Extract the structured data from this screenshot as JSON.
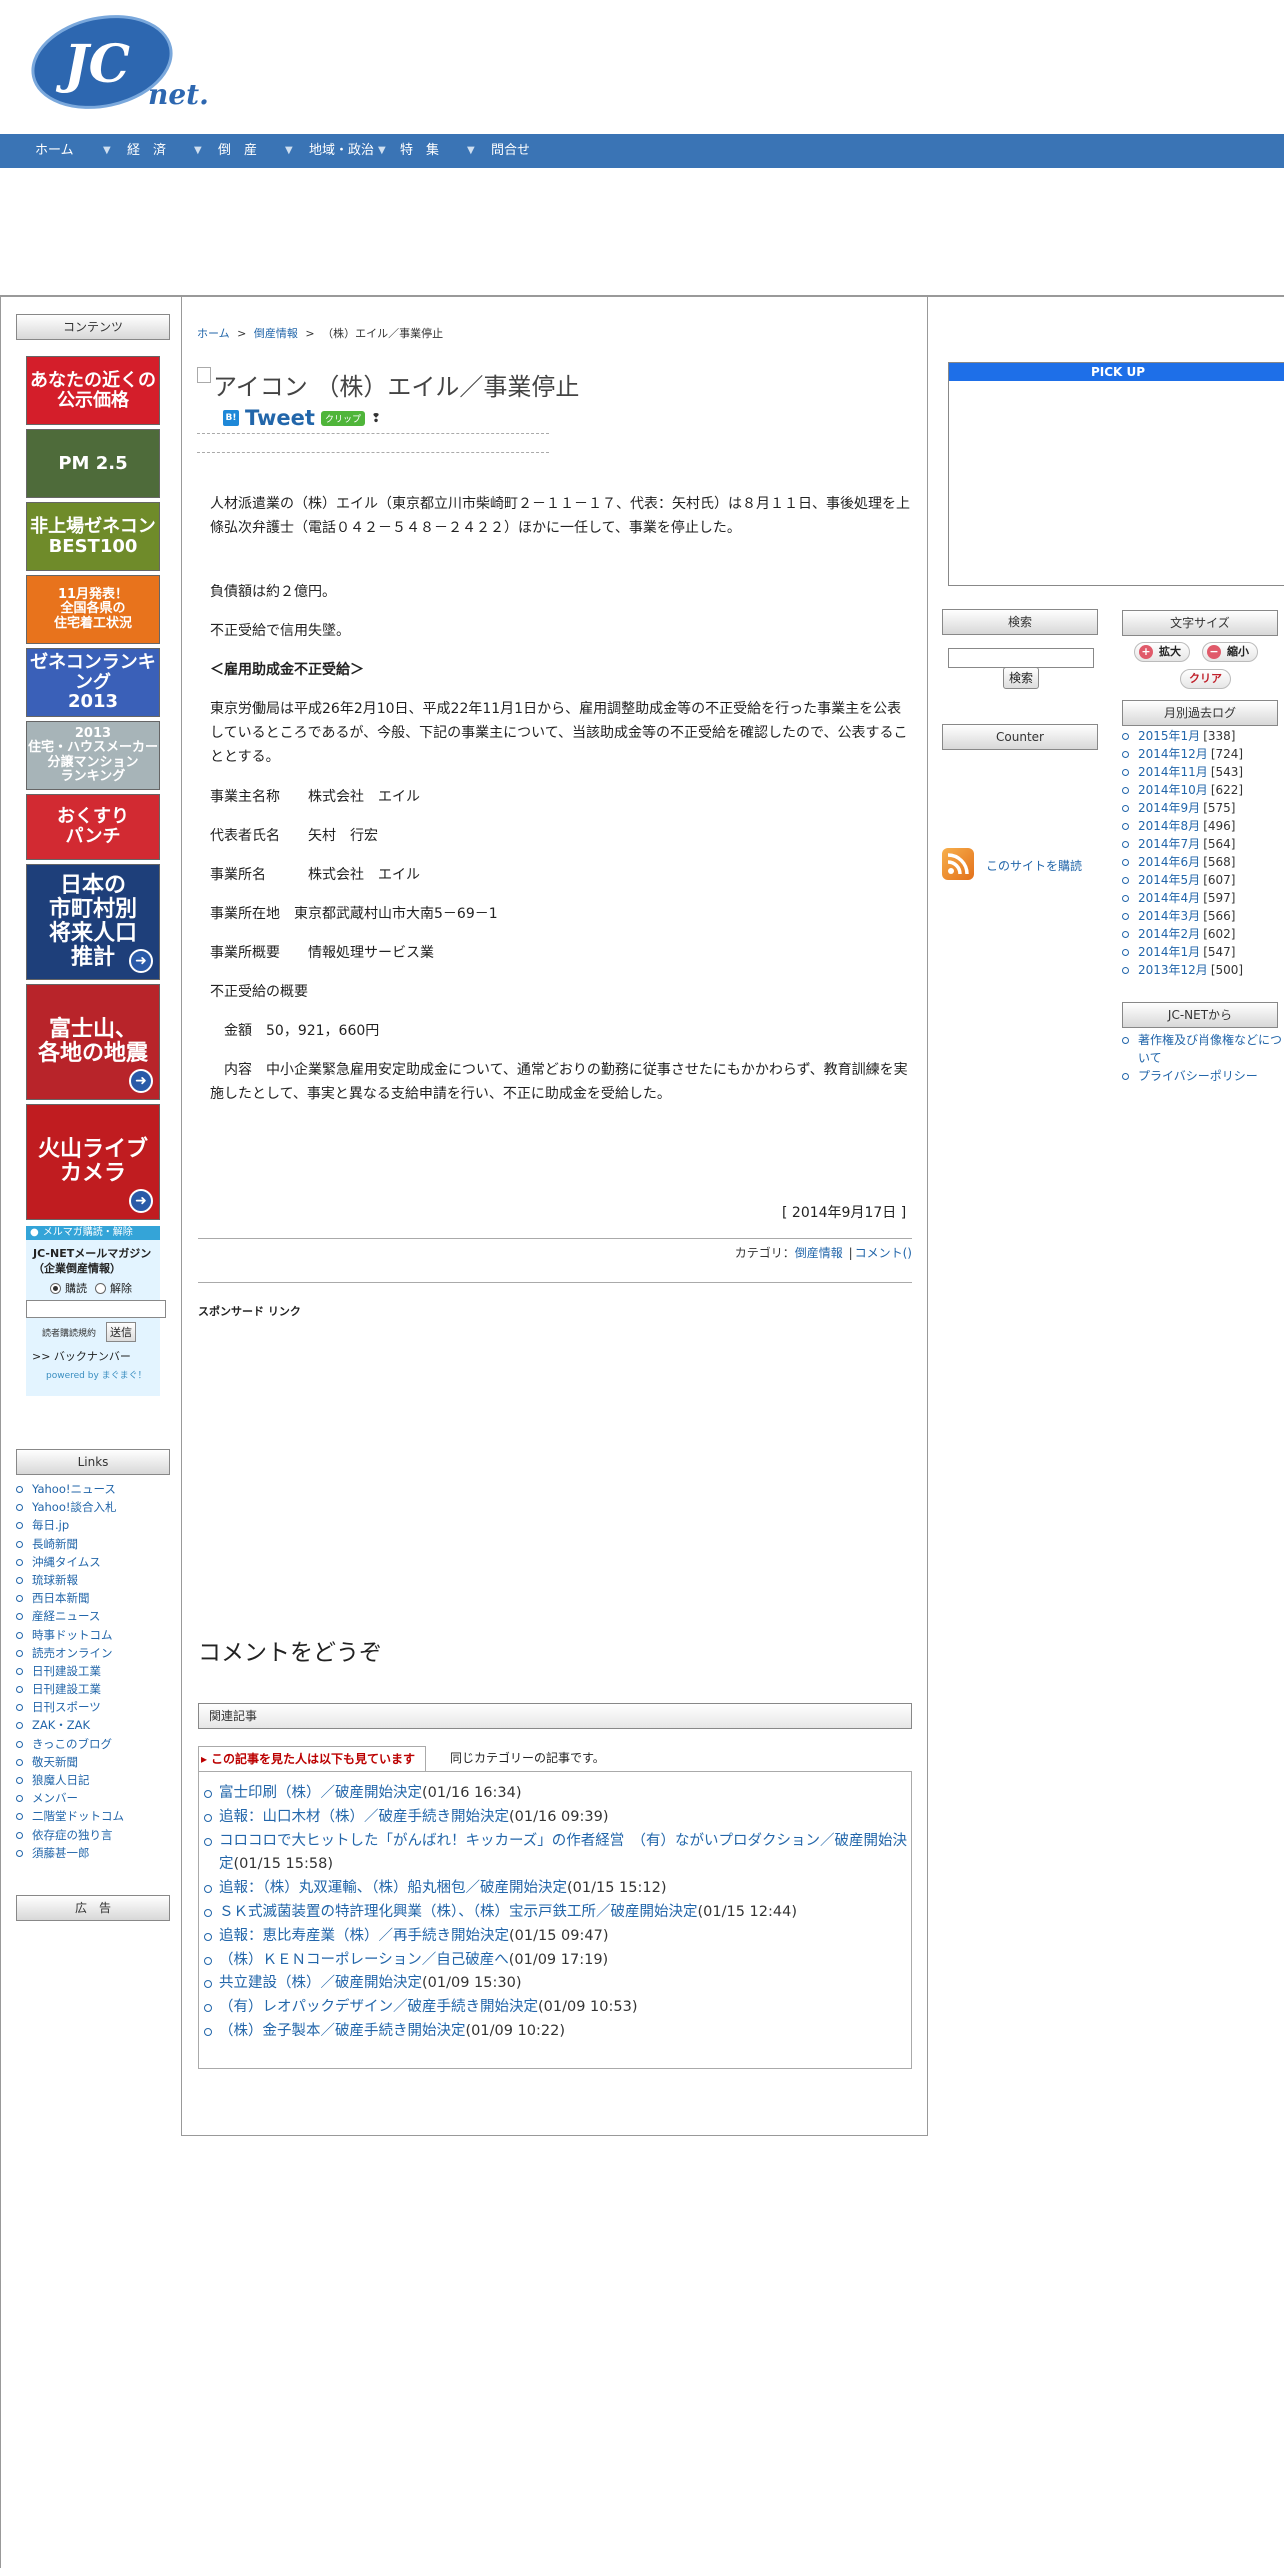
{
  "logo": {
    "text_main": "JC",
    "text_sub": "net."
  },
  "nav": {
    "items": [
      {
        "label": "ホーム"
      },
      {
        "label": "経　済"
      },
      {
        "label": "倒　産"
      },
      {
        "label": "地域・政治"
      },
      {
        "label": "特　集"
      },
      {
        "label": "問合せ"
      }
    ],
    "caret": "▼"
  },
  "left_sidebar": {
    "contents_label": "コンテンツ",
    "banners": [
      {
        "text": "あなたの近くの\n公示価格",
        "bg": "#d41e2a"
      },
      {
        "text": "PM 2.5",
        "bg": "#4e6b3a"
      },
      {
        "text": "非上場ゼネコン\nBEST100",
        "bg": "#6f8b2a"
      },
      {
        "text": "11月発表！\n全国各県の\n住宅着工状況",
        "bg": "#e8731c"
      },
      {
        "text": "ゼネコンランキング\n2013",
        "bg": "#3a60b8"
      },
      {
        "text": "2013\n住宅・ハウスメーカー\n分譲マンション\nランキング",
        "bg": "#a7b4b8"
      },
      {
        "text": "おくすり\nパンチ",
        "bg": "#d22a32"
      },
      {
        "text": "日本の\n市町村別\n将来人口\n推計",
        "bg": "#1e3f7a"
      },
      {
        "text": "富士山、\n各地の地震",
        "bg": "#b8242a"
      },
      {
        "text": "火山ライブ\nカメラ",
        "bg": "#c01c20"
      }
    ],
    "mailmag": {
      "header": "メルマガ購読・解除",
      "title": "JC-NETメールマガジン（企業倒産情報）",
      "subscribe": "購読",
      "unsubscribe": "解除",
      "terms": "読者購読規約",
      "submit": "送信",
      "backnumber": ">> バックナンバー",
      "powered": "powered by まぐまぐ！"
    },
    "links_label": "Links",
    "links": [
      "Yahoo!ニュース",
      "Yahoo!談合入札",
      "毎日.jp",
      "長崎新聞",
      "沖縄タイムス",
      "琉球新報",
      "西日本新聞",
      "産経ニュース",
      "時事ドットコム",
      "読売オンライン",
      "日刊建設工業",
      "日刊建設工業",
      "日刊スポーツ",
      "ZAK・ZAK",
      "きっこのブログ",
      "敬天新聞",
      "狼魔人日記",
      "メンバー",
      "二階堂ドットコム",
      "依存症の独り言",
      "須藤甚一郎"
    ],
    "ad_label": "広　告"
  },
  "breadcrumb": {
    "home": "ホーム",
    "sep": ">",
    "category": "倒産情報",
    "current": "（株）エイル／事業停止"
  },
  "article": {
    "title": "アイコン （株）エイル／事業停止",
    "tweet": "Tweet",
    "clip": "クリップ",
    "paragraphs": [
      "人材派遣業の（株）エイル（東京都立川市柴崎町２－１１－１７、代表：矢村氏）は８月１１日、事後処理を上條弘次弁護士（電話０４２－５４８－２４２２）ほかに一任して、事業を停止した。",
      "負債額は約２億円。",
      "不正受給で信用失墜。",
      "＜雇用助成金不正受給＞",
      "東京労働局は平成26年2月10日、平成22年11月1日から、雇用調整助成金等の不正受給を行った事業主を公表しているところであるが、今般、下記の事業主について、当該助成金等の不正受給を確認したので、公表することとする。",
      "事業主名称　　株式会社　エイル",
      "代表者氏名　　矢村　行宏",
      "事業所名　　　株式会社　エイル",
      "事業所在地　東京都武蔵村山市大南5－69－1",
      "事業所概要　　情報処理サービス業",
      "不正受給の概要",
      "　金額　50，921，660円",
      "　内容　中小企業緊急雇用安定助成金について、通常どおりの勤務に従事させたにもかかわらず、教育訓練を実施したとして、事実と異なる支給申請を行い、不正に助成金を受給した。"
    ],
    "date": "[ 2014年9月17日 ]",
    "category_label": "カテゴリ：",
    "category_value": "倒産情報",
    "category_sep": "|",
    "comment_link": "コメント()",
    "sponsored": "スポンサード リンク",
    "comment_heading": "コメントをどうぞ"
  },
  "related": {
    "heading": "関連記事",
    "tab_active": "この記事を見た人は以下も見ています",
    "tab_other": "同じカテゴリーの記事です。",
    "items": [
      {
        "title": "富士印刷（株）／破産開始決定",
        "date": "(01/16 16:34)"
      },
      {
        "title": "追報：山口木材（株）／破産手続き開始決定",
        "date": "(01/16 09:39)"
      },
      {
        "title": "コロコロで大ヒットした「がんばれ！キッカーズ」の作者経営　（有）ながいプロダクション／破産開始決定",
        "date": "(01/15 15:58)"
      },
      {
        "title": "追報：（株）丸双運輸、（株）船丸梱包／破産開始決定",
        "date": "(01/15 15:12)"
      },
      {
        "title": "ＳＫ式滅菌装置の特許理化興業（株）、（株）宝示戸鉄工所／破産開始決定",
        "date": "(01/15 12:44)"
      },
      {
        "title": "追報：恵比寿産業（株）／再手続き開始決定",
        "date": "(01/15 09:47)"
      },
      {
        "title": "（株）ＫＥＮコーポレーション／自己破産へ",
        "date": "(01/09 17:19)"
      },
      {
        "title": "共立建設（株）／破産開始決定",
        "date": "(01/09 15:30)"
      },
      {
        "title": "（有）レオパックデザイン／破産手続き開始決定",
        "date": "(01/09 10:53)"
      },
      {
        "title": "（株）金子製本／破産手続き開始決定",
        "date": "(01/09 10:22)"
      }
    ]
  },
  "right_sidebar": {
    "pickup": "PICK UP",
    "search_label": "検索",
    "search_button": "検索",
    "counter_label": "Counter",
    "rss_text": "このサイトを購読",
    "fontsize_label": "文字サイズ",
    "fs_large": "拡大",
    "fs_small": "縮小",
    "fs_clear": "クリア",
    "archive_label": "月別過去ログ",
    "archive": [
      {
        "month": "2015年1月",
        "count": "[338]"
      },
      {
        "month": "2014年12月",
        "count": "[724]"
      },
      {
        "month": "2014年11月",
        "count": "[543]"
      },
      {
        "month": "2014年10月",
        "count": "[622]"
      },
      {
        "month": "2014年9月",
        "count": "[575]"
      },
      {
        "month": "2014年8月",
        "count": "[496]"
      },
      {
        "month": "2014年7月",
        "count": "[564]"
      },
      {
        "month": "2014年6月",
        "count": "[568]"
      },
      {
        "month": "2014年5月",
        "count": "[607]"
      },
      {
        "month": "2014年4月",
        "count": "[597]"
      },
      {
        "month": "2014年3月",
        "count": "[566]"
      },
      {
        "month": "2014年2月",
        "count": "[602]"
      },
      {
        "month": "2014年1月",
        "count": "[547]"
      },
      {
        "month": "2013年12月",
        "count": "[500]"
      }
    ],
    "jcnet_label": "JC-NETから",
    "jcnet_links": [
      "著作権及び肖像権などについて",
      "プライバシーポリシー"
    ]
  },
  "colors": {
    "nav_bg": "#3a74b5",
    "link": "#2266aa",
    "pickup_bg": "#1e6fe8",
    "logo_blue": "#2d67b0"
  }
}
